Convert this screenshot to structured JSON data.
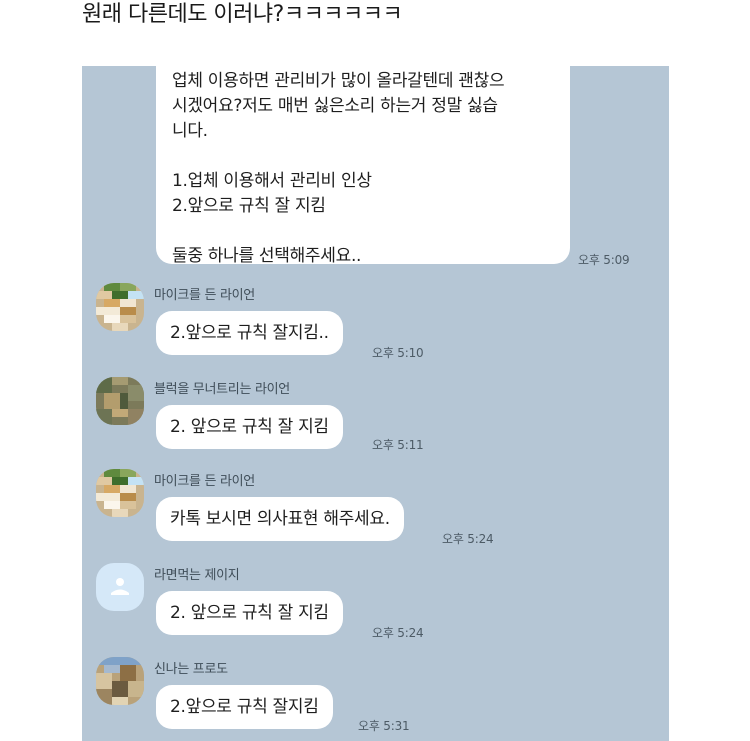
{
  "caption": "원래 다른데도 이러냐?ㅋㅋㅋㅋㅋㅋ",
  "first_message": {
    "text": "업체 이용하면 관리비가 많이 올라갈텐데 괜찮으\n시겠어요?저도 매번 싫은소리 하는거 정말 싫습\n니다.\n\n1.업체 이용해서 관리비 인상\n2.앞으로 규칙 잘 지킴\n\n둘중 하나를 선택해주세요..",
    "time": "오후 5:09"
  },
  "messages": [
    {
      "sender": "마이크를 든 라이언",
      "avatar": "pixelated-avatar-icon",
      "text": "2.앞으로 규칙 잘지킴..",
      "time": "오후 5:10"
    },
    {
      "sender": "블럭을 무너트리는 라이언",
      "avatar": "pixelated-avatar-icon",
      "text": "2. 앞으로 규칙 잘 지킴",
      "time": "오후 5:11"
    },
    {
      "sender": "마이크를 든 라이언",
      "avatar": "pixelated-avatar-icon",
      "text": "카톡 보시면 의사표현 해주세요.",
      "time": "오후 5:24"
    },
    {
      "sender": "라면먹는 제이지",
      "avatar": "default-profile-icon",
      "text": "2. 앞으로 규칙 잘 지킴",
      "time": "오후 5:24"
    },
    {
      "sender": "신나는 프로도",
      "avatar": "pixelated-avatar-icon",
      "text": "2.앞으로 규칙 잘지킴",
      "time": "오후 5:31"
    }
  ],
  "colors": {
    "chat_background": "#b5c6d5",
    "bubble": "#ffffff",
    "default_avatar": "#d5e8f8"
  }
}
